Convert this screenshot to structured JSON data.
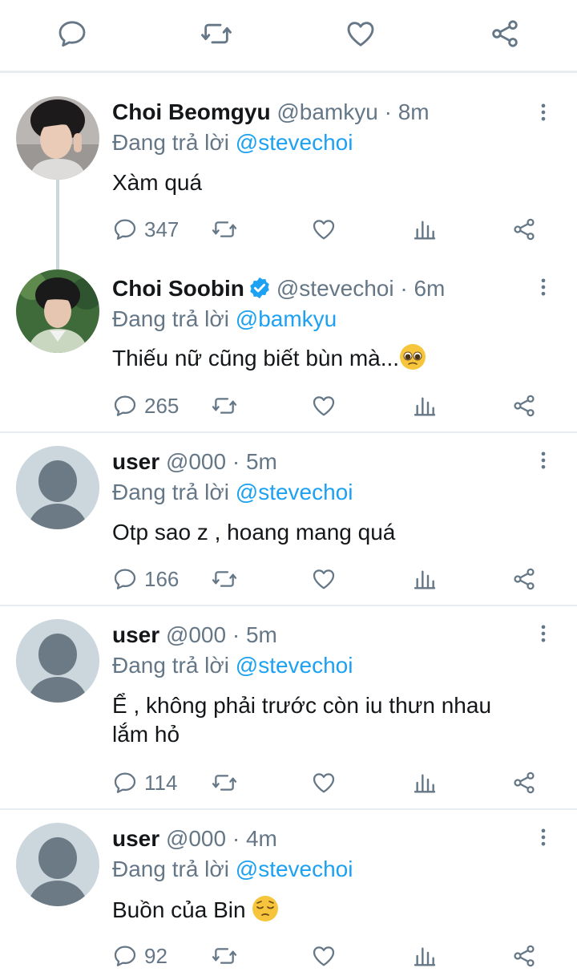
{
  "tweets": [
    {
      "name": "Choi Beomgyu",
      "handle": "@bamkyu",
      "time": "· 8m",
      "reply_prefix": "Đang trả lời",
      "reply_to": "@stevechoi",
      "text": "Xàm quá",
      "replies": "347"
    },
    {
      "name": "Choi Soobin",
      "handle": "@stevechoi",
      "time": "· 6m",
      "reply_prefix": "Đang trả lời",
      "reply_to": "@bamkyu",
      "text": "Thiếu nữ cũng biết bùn mà...",
      "replies": "265"
    },
    {
      "name": "user",
      "handle": "@000",
      "time": "· 5m",
      "reply_prefix": "Đang trả lời",
      "reply_to": "@stevechoi",
      "text": "Otp sao z , hoang mang quá",
      "replies": "166"
    },
    {
      "name": "user",
      "handle": "@000",
      "time": "· 5m",
      "reply_prefix": "Đang trả lời",
      "reply_to": "@stevechoi",
      "text_line1": "Ể , không phải trước còn iu thưn nhau",
      "text_line2": "lắm hỏ",
      "replies": "114"
    },
    {
      "name": "user",
      "handle": "@000",
      "time": "· 4m",
      "reply_prefix": "Đang trả lời",
      "reply_to": "@stevechoi",
      "text": "Buồn của Bin",
      "replies": "92"
    }
  ],
  "icons": {
    "reply": "comment-icon",
    "retweet": "retweet-icon",
    "like": "heart-icon",
    "stats": "analytics-icon",
    "share": "share-icon",
    "more": "more-vertical-icon",
    "verified": "verified-badge-icon"
  },
  "colors": {
    "link": "#1da1f2",
    "muted": "#657786",
    "divider": "#e6ecf0",
    "verified": "#1da1f2"
  }
}
